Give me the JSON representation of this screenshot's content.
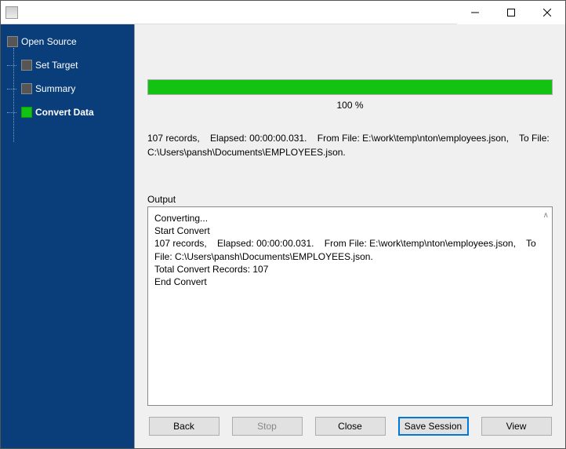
{
  "window": {
    "title": ""
  },
  "sidebar": {
    "root": {
      "label": "Open Source"
    },
    "children": [
      {
        "id": "set-target",
        "label": "Set Target",
        "active": false
      },
      {
        "id": "summary",
        "label": "Summary",
        "active": false
      },
      {
        "id": "convert-data",
        "label": "Convert Data",
        "active": true
      }
    ]
  },
  "progress": {
    "percent": 100,
    "text": "100 %"
  },
  "summary_line": "107 records,    Elapsed: 00:00:00.031.    From File: E:\\work\\temp\\nton\\employees.json,    To File: C:\\Users\\pansh\\Documents\\EMPLOYEES.json.",
  "output": {
    "label": "Output",
    "lines": [
      "Converting...",
      "Start Convert",
      "107 records,    Elapsed: 00:00:00.031.    From File: E:\\work\\temp\\nton\\employees.json,    To File: C:\\Users\\pansh\\Documents\\EMPLOYEES.json.",
      "Total Convert Records: 107",
      "End Convert"
    ]
  },
  "buttons": {
    "back": "Back",
    "stop": "Stop",
    "close": "Close",
    "save_session": "Save Session",
    "view": "View"
  }
}
